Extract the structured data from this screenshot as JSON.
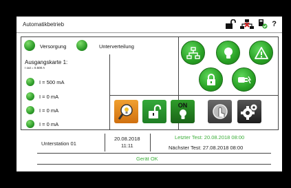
{
  "header": {
    "title": "Automatikbetrieb",
    "help_label": "?",
    "icons": [
      "unlock-icon",
      "network-error-icon",
      "device-check-icon",
      "help-icon"
    ]
  },
  "status": {
    "versorgung_label": "Versorgung",
    "unterverteilung_label": "Unterverteilung",
    "card_title": "Ausgangskarte 1:",
    "card_subtitle": "I out = 0.500 A",
    "outputs": [
      {
        "label": "I = 500 mA"
      },
      {
        "label": "I = 0 mA"
      },
      {
        "label": "I = 0 mA"
      },
      {
        "label": "I = 0 mA"
      }
    ]
  },
  "actions": {
    "round_buttons": [
      "network-icon",
      "bulb-icon",
      "warning-icon",
      "lock-icon",
      "plug-icon"
    ],
    "tiles": [
      {
        "icon": "search-bulb-icon"
      },
      {
        "icon": "unlock-tile-icon"
      },
      {
        "icon": "bulb-on-icon",
        "text": "ON"
      },
      {
        "icon": "touch-icon"
      },
      {
        "icon": "settings-icon"
      }
    ]
  },
  "footer": {
    "station": "Unterstation 01",
    "date": "20.08.2018",
    "time": "11:11",
    "last_test": "Letzter Test: 20.08.2018 08:00",
    "next_test": "Nächster Test: 27.08.2018 08:00",
    "status": "Gerät OK"
  },
  "colors": {
    "accent_green": "#3cae3a",
    "led_green": "#2e9c2a"
  }
}
